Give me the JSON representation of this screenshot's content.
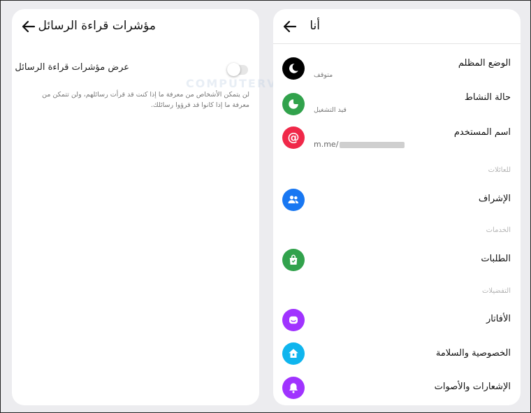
{
  "left_panel": {
    "title": "مؤشرات قراءة الرسائل",
    "toggle_label": "عرض مؤشرات قراءة الرسائل",
    "toggle_on": false,
    "description": "لن يتمكن الأشخاص من معرفة ما إذا كنت قد قرأت رسائلهم، ولن تتمكن من معرفة ما إذا كانوا قد قرؤوا رسائلك."
  },
  "right_panel": {
    "title": "أنا",
    "items": [
      {
        "label": "الوضع المظلم",
        "sublabel": "متوقف",
        "icon": "moon-icon",
        "color": "#000000"
      },
      {
        "label": "حالة النشاط",
        "sublabel": "قيد التشغيل",
        "icon": "active-status-icon",
        "color": "#31a24c"
      },
      {
        "label": "اسم المستخدم",
        "sublabel": "m.me/",
        "icon": "at-sign-icon",
        "color": "#f02849"
      }
    ],
    "sections": [
      {
        "label": "للعائلات",
        "items": [
          {
            "label": "الإشراف",
            "icon": "people-icon",
            "color": "#1877f2"
          }
        ]
      },
      {
        "label": "الخدمات",
        "items": [
          {
            "label": "الطلبات",
            "icon": "shopping-bag-icon",
            "color": "#31a24c"
          }
        ]
      },
      {
        "label": "التفضيلات",
        "items": [
          {
            "label": "الأفاتار",
            "icon": "avatar-face-icon",
            "color": "#a033ff"
          },
          {
            "label": "الخصوصية والسلامة",
            "icon": "privacy-home-icon",
            "color": "#0fb5ee"
          },
          {
            "label": "الإشعارات والأصوات",
            "icon": "bell-icon",
            "color": "#a033ff"
          }
        ]
      }
    ]
  },
  "watermark": "COMPUTERVO.COM"
}
